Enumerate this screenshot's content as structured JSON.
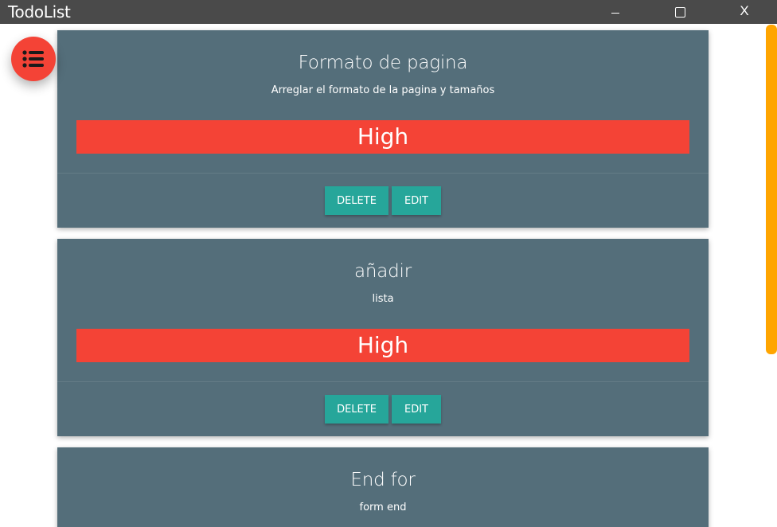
{
  "window": {
    "title": "TodoList",
    "close_label": "X"
  },
  "fab": {
    "icon": "list-icon",
    "color": "#f44336"
  },
  "scrollbar": {
    "color": "#ffa500"
  },
  "colors": {
    "card_bg": "#546e7a",
    "priority_high": "#f44336",
    "button": "#26a69a"
  },
  "todos": [
    {
      "title": "Formato de pagina",
      "description": "Arreglar el formato de la pagina y tamaños",
      "priority": "High",
      "delete_label": "DELETE",
      "edit_label": "EDIT"
    },
    {
      "title": "añadir",
      "description": "lista",
      "priority": "High",
      "delete_label": "DELETE",
      "edit_label": "EDIT"
    },
    {
      "title": "End for",
      "description": "form end",
      "priority": "",
      "delete_label": "",
      "edit_label": ""
    }
  ]
}
